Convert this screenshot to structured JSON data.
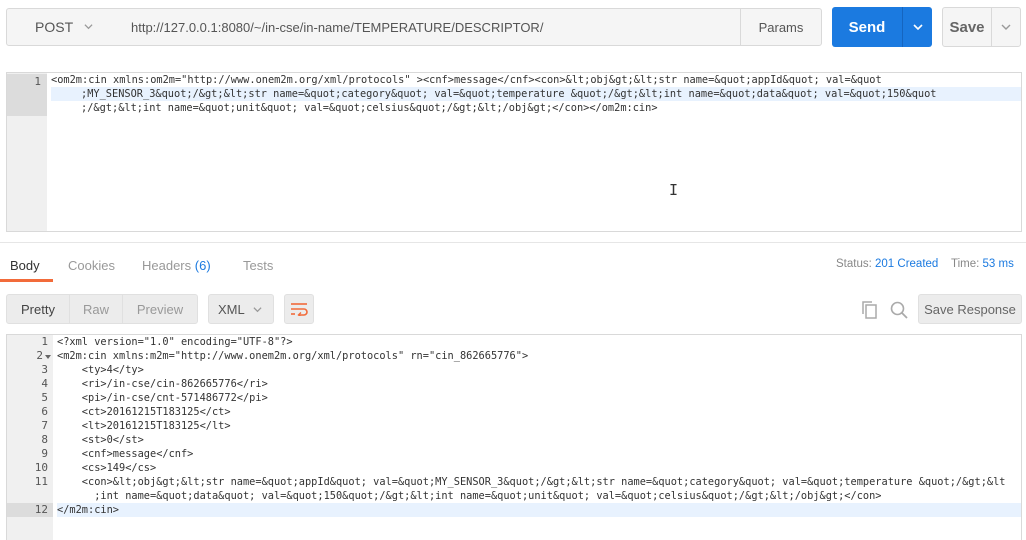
{
  "request": {
    "method": "POST",
    "url": "http://127.0.0.1:8080/~/in-cse/in-name/TEMPERATURE/DESCRIPTOR/",
    "params_label": "Params",
    "send_label": "Send",
    "save_label": "Save"
  },
  "request_body": {
    "line_number": "1",
    "line1_pre": "<om2m:cin xmlns:om2m=\"http://www.onem2m.org/xml/protocols\" ><cnf>message</cnf><con>&lt;obj&gt;&lt;str name=&quot;appId&quot; val=&quot",
    "line2": ";MY_SENSOR_3&quot;/&gt;&lt;str name=&quot;category&quot; val=&quot;temperature &quot;/&gt;&lt;int name=&quot;data&quot; val=&quot;150&quot",
    "line3": ";/&gt;&lt;int name=&quot;unit&quot; val=&quot;celsius&quot;/&gt;&lt;/obj&gt;</con></om2m:cin>"
  },
  "response": {
    "tabs": [
      {
        "label": "Body"
      },
      {
        "label": "Cookies"
      },
      {
        "label": "Headers",
        "count": "(6)"
      },
      {
        "label": "Tests"
      }
    ],
    "status_label": "Status:",
    "status_value": "201 Created",
    "time_label": "Time:",
    "time_value": "53 ms",
    "view_modes": [
      "Pretty",
      "Raw",
      "Preview"
    ],
    "format": "XML",
    "save_response_label": "Save Response",
    "line_numbers": [
      "1",
      "2",
      "3",
      "4",
      "5",
      "6",
      "7",
      "8",
      "9",
      "10",
      "11",
      "",
      "12"
    ],
    "lines": [
      "<?xml version=\"1.0\" encoding=\"UTF-8\"?>",
      "<m2m:cin xmlns:m2m=\"http://www.onem2m.org/xml/protocols\" rn=\"cin_862665776\">",
      "    <ty>4</ty>",
      "    <ri>/in-cse/cin-862665776</ri>",
      "    <pi>/in-cse/cnt-571486772</pi>",
      "    <ct>20161215T183125</ct>",
      "    <lt>20161215T183125</lt>",
      "    <st>0</st>",
      "    <cnf>message</cnf>",
      "    <cs>149</cs>",
      "    <con>&lt;obj&gt;&lt;str name=&quot;appId&quot; val=&quot;MY_SENSOR_3&quot;/&gt;&lt;str name=&quot;category&quot; val=&quot;temperature &quot;/&gt;&lt",
      "      ;int name=&quot;data&quot; val=&quot;150&quot;/&gt;&lt;int name=&quot;unit&quot; val=&quot;celsius&quot;/&gt;&lt;/obj&gt;</con>",
      "</m2m:cin>"
    ]
  },
  "colors": {
    "accent": "#1b7ae0",
    "tab_underline": "#f26b3a"
  }
}
